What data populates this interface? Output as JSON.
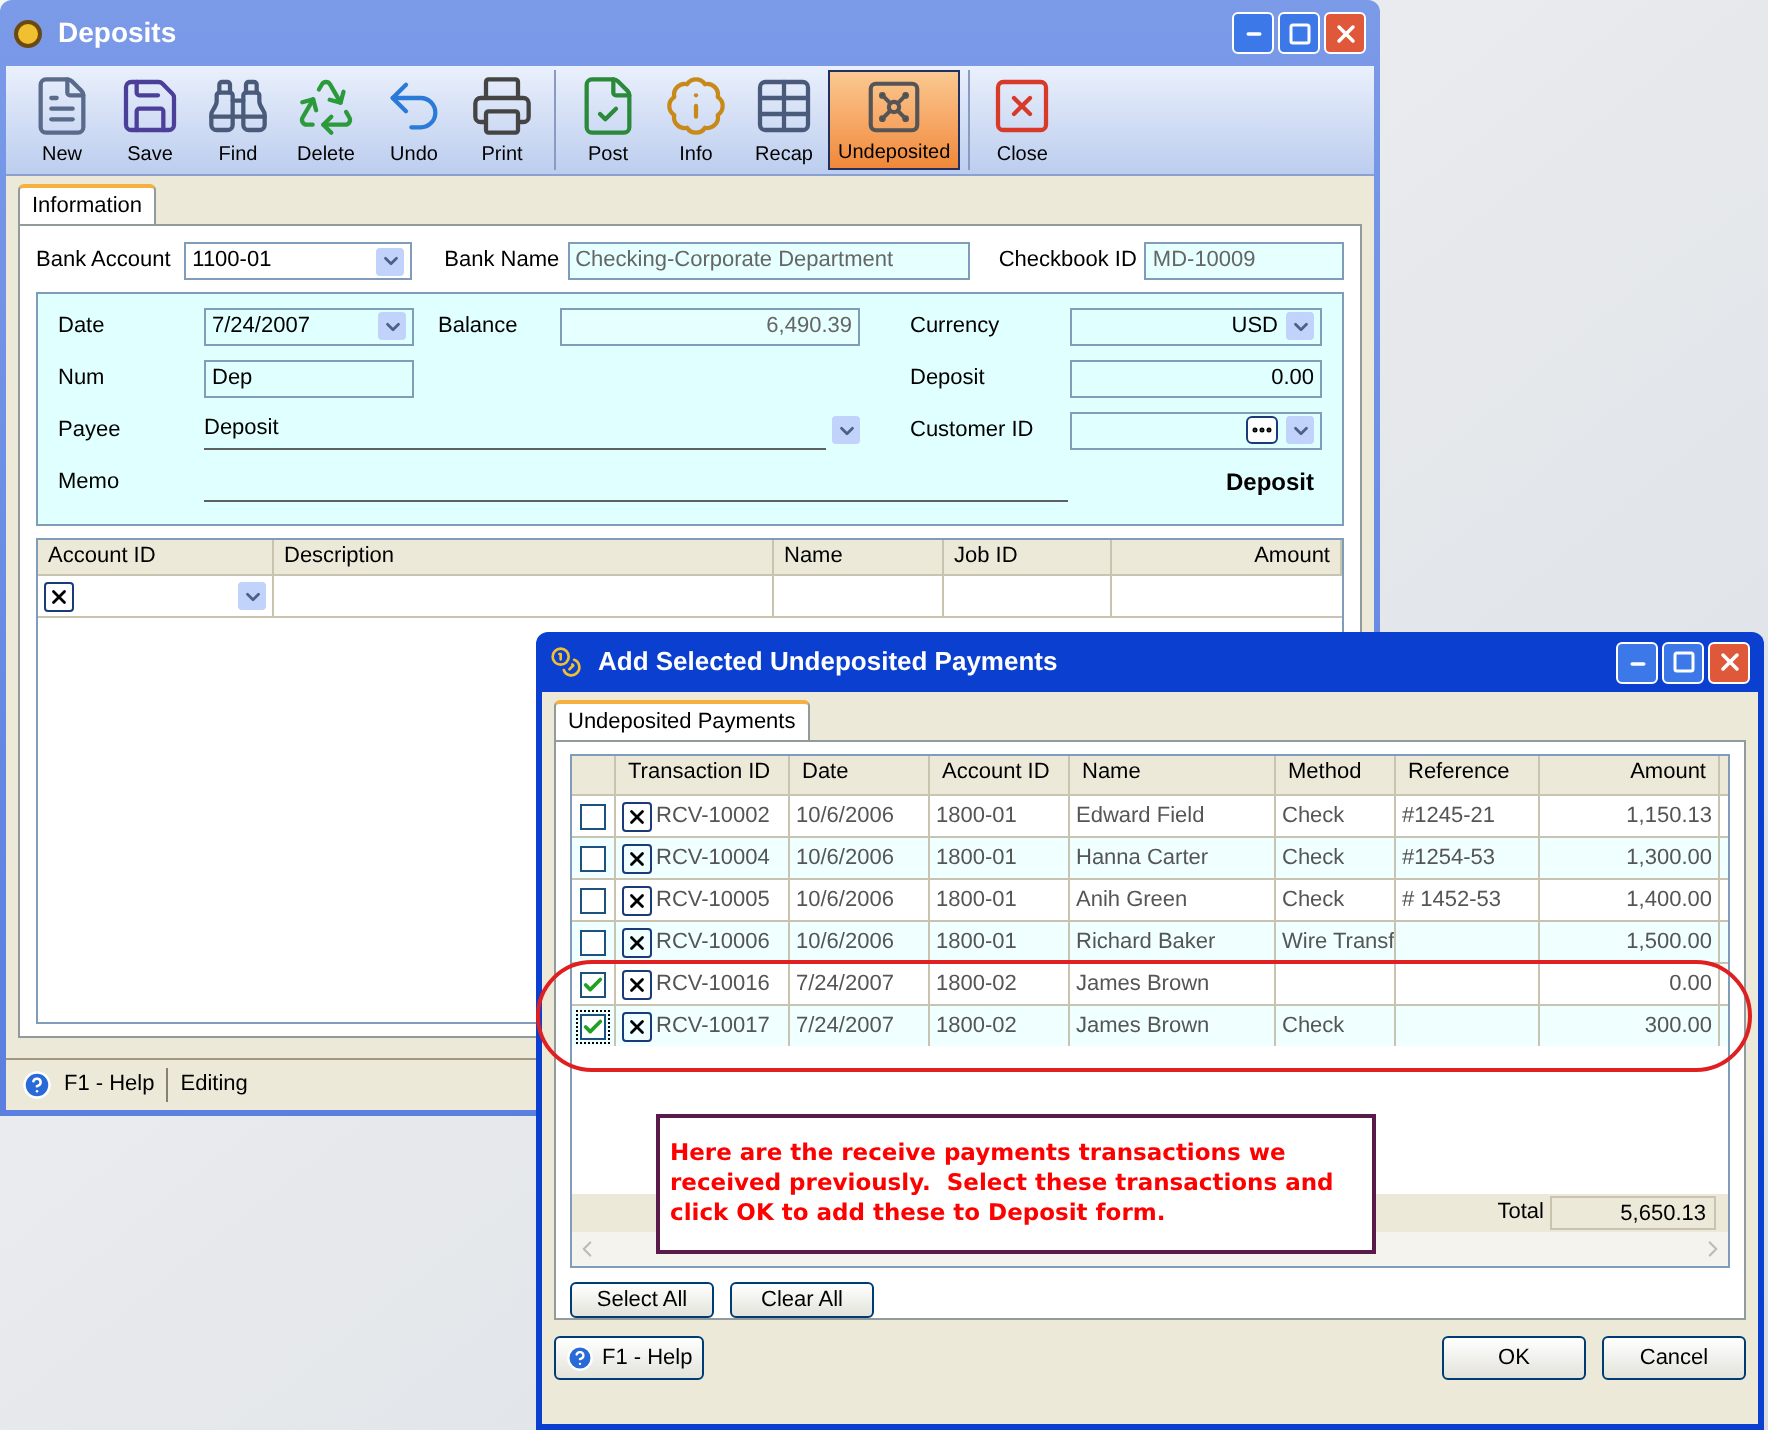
{
  "main_window": {
    "title": "Deposits",
    "toolbar": [
      [
        {
          "label": "New",
          "selected": false
        },
        {
          "label": "Save",
          "selected": false
        },
        {
          "label": "Find",
          "selected": false
        },
        {
          "label": "Delete",
          "selected": false
        },
        {
          "label": "Undo",
          "selected": false
        },
        {
          "label": "Print",
          "selected": false
        }
      ],
      [
        {
          "label": "Post",
          "selected": false
        },
        {
          "label": "Info",
          "selected": false
        },
        {
          "label": "Recap",
          "selected": false
        },
        {
          "label": "Undeposited",
          "selected": true
        }
      ],
      [
        {
          "label": "Close",
          "selected": false
        }
      ]
    ],
    "tabs": [
      {
        "label": "Information",
        "selected": true
      }
    ],
    "bank_account": {
      "label": "Bank Account",
      "value": "1100-01"
    },
    "bank_name": {
      "label": "Bank Name",
      "value": "Checking-Corporate Department"
    },
    "checkbook_id": {
      "label": "Checkbook ID",
      "value": "MD-10009"
    },
    "date": {
      "label": "Date",
      "value": "7/24/2007"
    },
    "balance": {
      "label": "Balance",
      "value": "6,490.39"
    },
    "currency": {
      "label": "Currency",
      "value": "USD"
    },
    "num": {
      "label": "Num",
      "value": "Dep"
    },
    "deposit": {
      "label": "Deposit",
      "value": "0.00"
    },
    "payee": {
      "label": "Payee",
      "value": "Deposit"
    },
    "customer_id": {
      "label": "Customer ID"
    },
    "memo": {
      "label": "Memo"
    },
    "form_type": "Deposit",
    "grid": {
      "columns": [
        "Account ID",
        "Description",
        "Name",
        "Job ID",
        "Amount"
      ]
    },
    "status_bar": {
      "help": "F1 - Help",
      "mode": "Editing"
    }
  },
  "dialog": {
    "title": "Add Selected Undeposited Payments",
    "tabs": [
      {
        "label": "Undeposited Payments",
        "selected": true
      }
    ],
    "columns": [
      "Transaction ID",
      "Date",
      "Account ID",
      "Name",
      "Method",
      "Reference",
      "Amount"
    ],
    "rows": [
      {
        "checked": false,
        "cells": [
          "RCV-10002",
          "10/6/2006",
          "1800-01",
          "Edward  Field",
          "Check",
          "#1245-21",
          "1,150.13"
        ]
      },
      {
        "checked": false,
        "cells": [
          "RCV-10004",
          "10/6/2006",
          "1800-01",
          "Hanna  Carter",
          "Check",
          "#1254-53",
          "1,300.00"
        ]
      },
      {
        "checked": false,
        "cells": [
          "RCV-10005",
          "10/6/2006",
          "1800-01",
          "Anih  Green",
          "Check",
          "# 1452-53",
          "1,400.00"
        ]
      },
      {
        "checked": false,
        "cells": [
          "RCV-10006",
          "10/6/2006",
          "1800-01",
          "Richard  Baker",
          "Wire Transf",
          "",
          "1,500.00"
        ]
      },
      {
        "checked": true,
        "cells": [
          "RCV-10016",
          "7/24/2007",
          "1800-02",
          "James Brown",
          "",
          "",
          "0.00"
        ]
      },
      {
        "checked": true,
        "cells": [
          "RCV-10017",
          "7/24/2007",
          "1800-02",
          "James Brown",
          "Check",
          "",
          "300.00"
        ]
      }
    ],
    "total_label": "Total",
    "total": "5,650.13",
    "callout": "Here are the receive payments transactions we received previously.  Select these transactions and click OK to add these to Deposit form.",
    "buttons": [
      "Select All",
      "Clear All"
    ],
    "help": "F1 - Help",
    "ok": "OK",
    "cancel": "Cancel"
  }
}
